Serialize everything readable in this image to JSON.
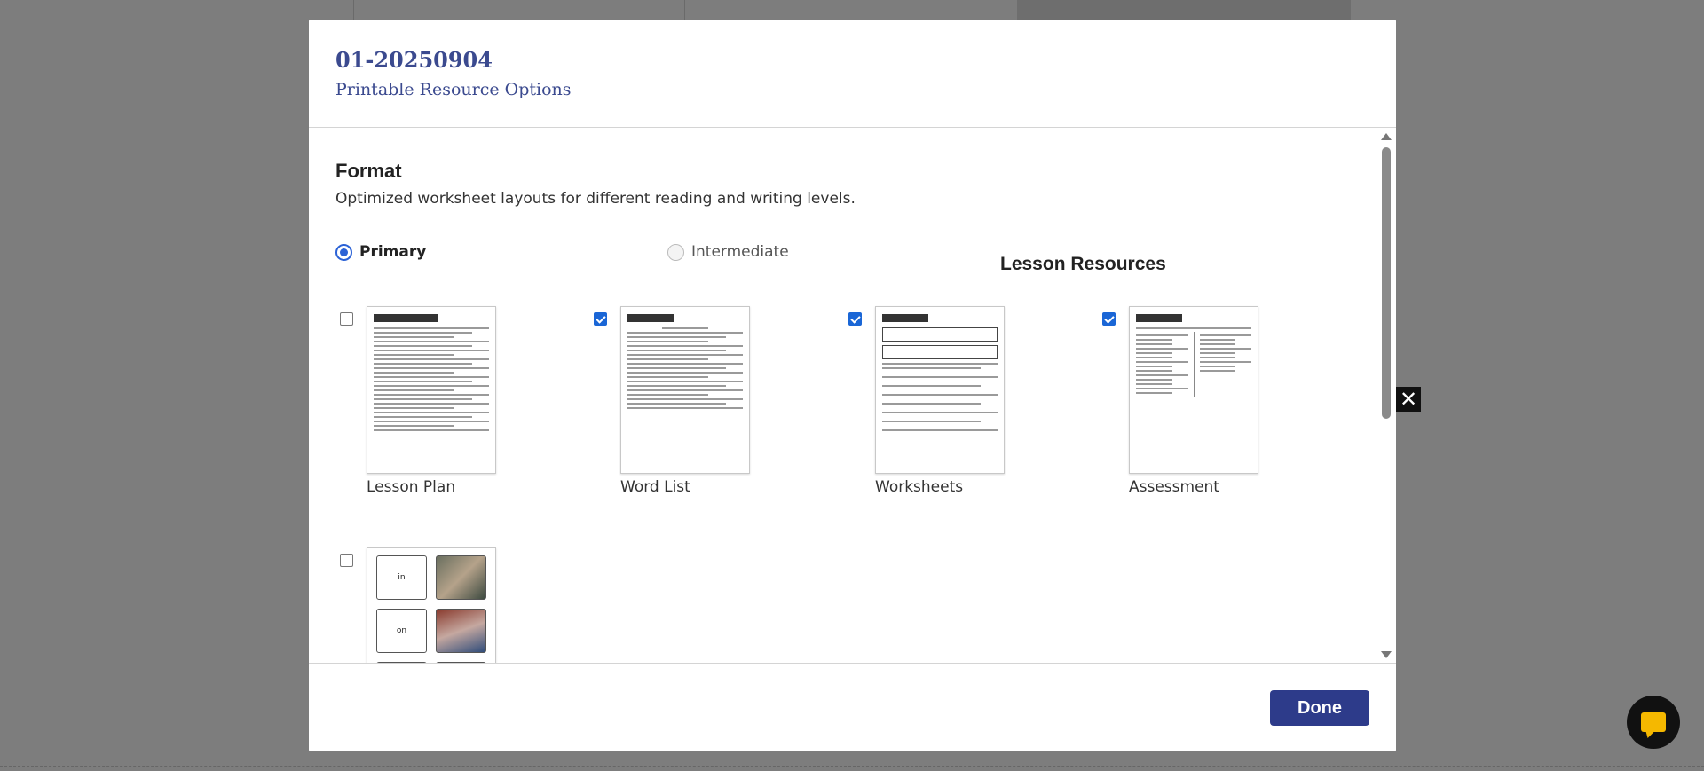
{
  "modal": {
    "code": "01-20250904",
    "subtitle": "Printable Resource Options"
  },
  "format": {
    "title": "Format",
    "description": "Optimized worksheet layouts for different reading and writing levels.",
    "options": [
      {
        "label": "Primary",
        "selected": true
      },
      {
        "label": "Intermediate",
        "selected": false
      }
    ]
  },
  "resources": {
    "title": "Lesson Resources",
    "items": [
      {
        "label": "Lesson Plan",
        "checked": false
      },
      {
        "label": "Word List",
        "checked": true
      },
      {
        "label": "Worksheets",
        "checked": true
      },
      {
        "label": "Assessment",
        "checked": true
      },
      {
        "label": "",
        "checked": false,
        "flashcards": [
          "in",
          "on"
        ]
      }
    ]
  },
  "footer": {
    "done_label": "Done"
  },
  "icons": {
    "close": "close-icon",
    "chat": "chat-icon"
  },
  "colors": {
    "accent": "#2d3b8a",
    "title": "#3b4a8f",
    "checkbox": "#1a66d6"
  }
}
